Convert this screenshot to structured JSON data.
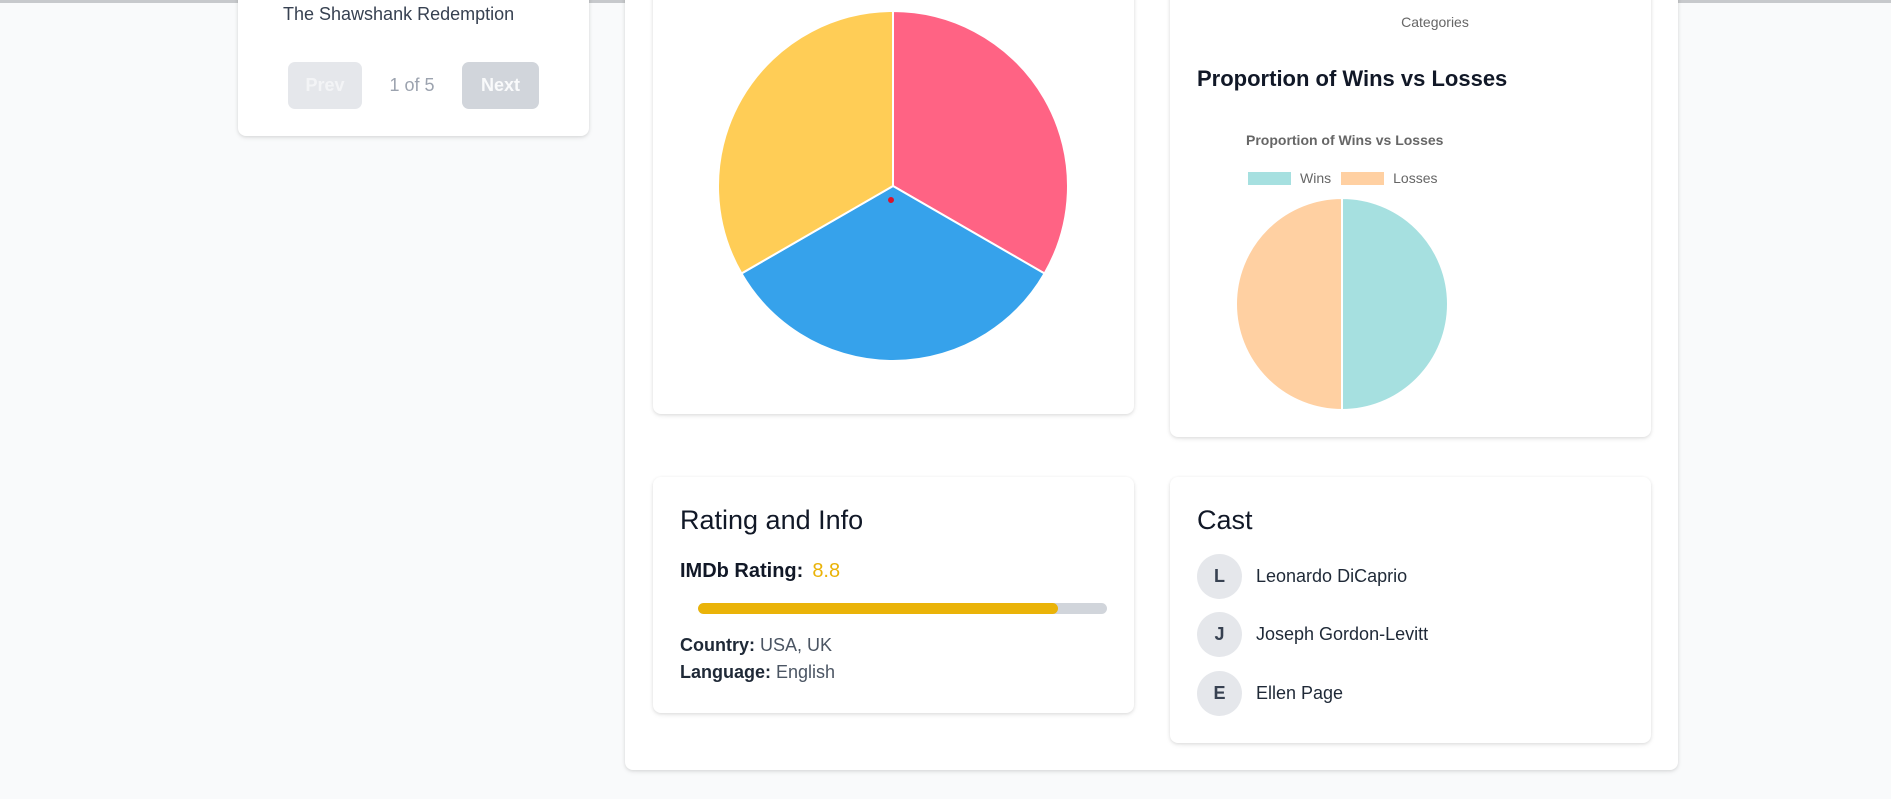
{
  "sidebar": {
    "selected_title": "The Shawshank Redemption",
    "prev_label": "Prev",
    "next_label": "Next",
    "page_indicator": "1 of 5"
  },
  "top_chart": {
    "x_axis_label": "Categories"
  },
  "chart_data": [
    {
      "type": "pie",
      "values": [
        1,
        1,
        1
      ],
      "colors": [
        "#ff6384",
        "#36a2eb",
        "#ffcd56"
      ]
    },
    {
      "type": "pie",
      "title": "Proportion of Wins vs Losses",
      "categories": [
        "Wins",
        "Losses"
      ],
      "values": [
        1,
        1
      ],
      "colors": [
        "#a6e0e0",
        "#ffd0a2"
      ],
      "legend": "top"
    }
  ],
  "wins_losses": {
    "heading": "Proportion of Wins vs Losses"
  },
  "rating_info": {
    "heading": "Rating and Info",
    "imdb_label": "IMDb Rating:",
    "imdb_value": "8.8",
    "imdb_fraction": 0.88,
    "country_label": "Country:",
    "country_value": "USA, UK",
    "language_label": "Language:",
    "language_value": "English",
    "accent_color": "#eab308"
  },
  "cast": {
    "heading": "Cast",
    "members": [
      {
        "initial": "L",
        "name": "Leonardo DiCaprio"
      },
      {
        "initial": "J",
        "name": "Joseph Gordon-Levitt"
      },
      {
        "initial": "E",
        "name": "Ellen Page"
      }
    ]
  }
}
